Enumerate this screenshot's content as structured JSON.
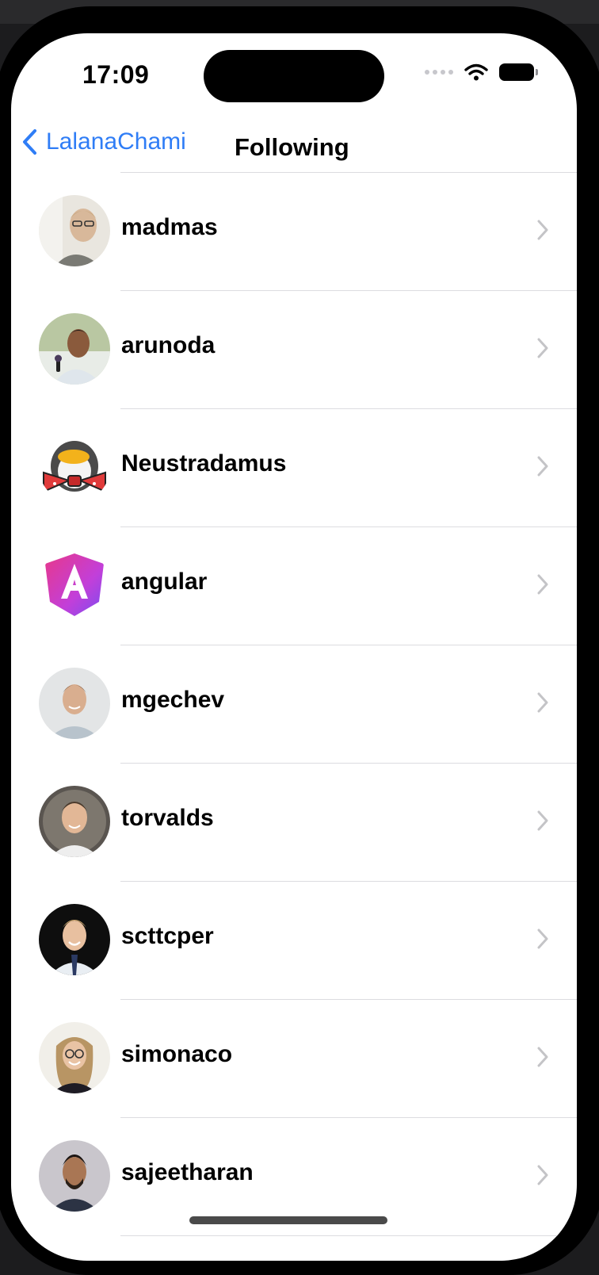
{
  "status_bar": {
    "time": "17:09"
  },
  "nav": {
    "back_label": "LalanaChami",
    "title": "Following"
  },
  "following": [
    {
      "name": "madmas",
      "avatar": "photo-avatar"
    },
    {
      "name": "arunoda",
      "avatar": "photo-avatar"
    },
    {
      "name": "Neustradamus",
      "avatar": "penguin-bowtie-avatar"
    },
    {
      "name": "angular",
      "avatar": "angular-logo-avatar"
    },
    {
      "name": "mgechev",
      "avatar": "photo-avatar"
    },
    {
      "name": "torvalds",
      "avatar": "photo-avatar"
    },
    {
      "name": "scttcper",
      "avatar": "photo-avatar"
    },
    {
      "name": "simonaco",
      "avatar": "photo-avatar"
    },
    {
      "name": "sajeetharan",
      "avatar": "photo-avatar"
    }
  ],
  "colors": {
    "accent": "#2f7df6",
    "chevron": "#c4c4c7",
    "separator": "#dcdce0"
  }
}
